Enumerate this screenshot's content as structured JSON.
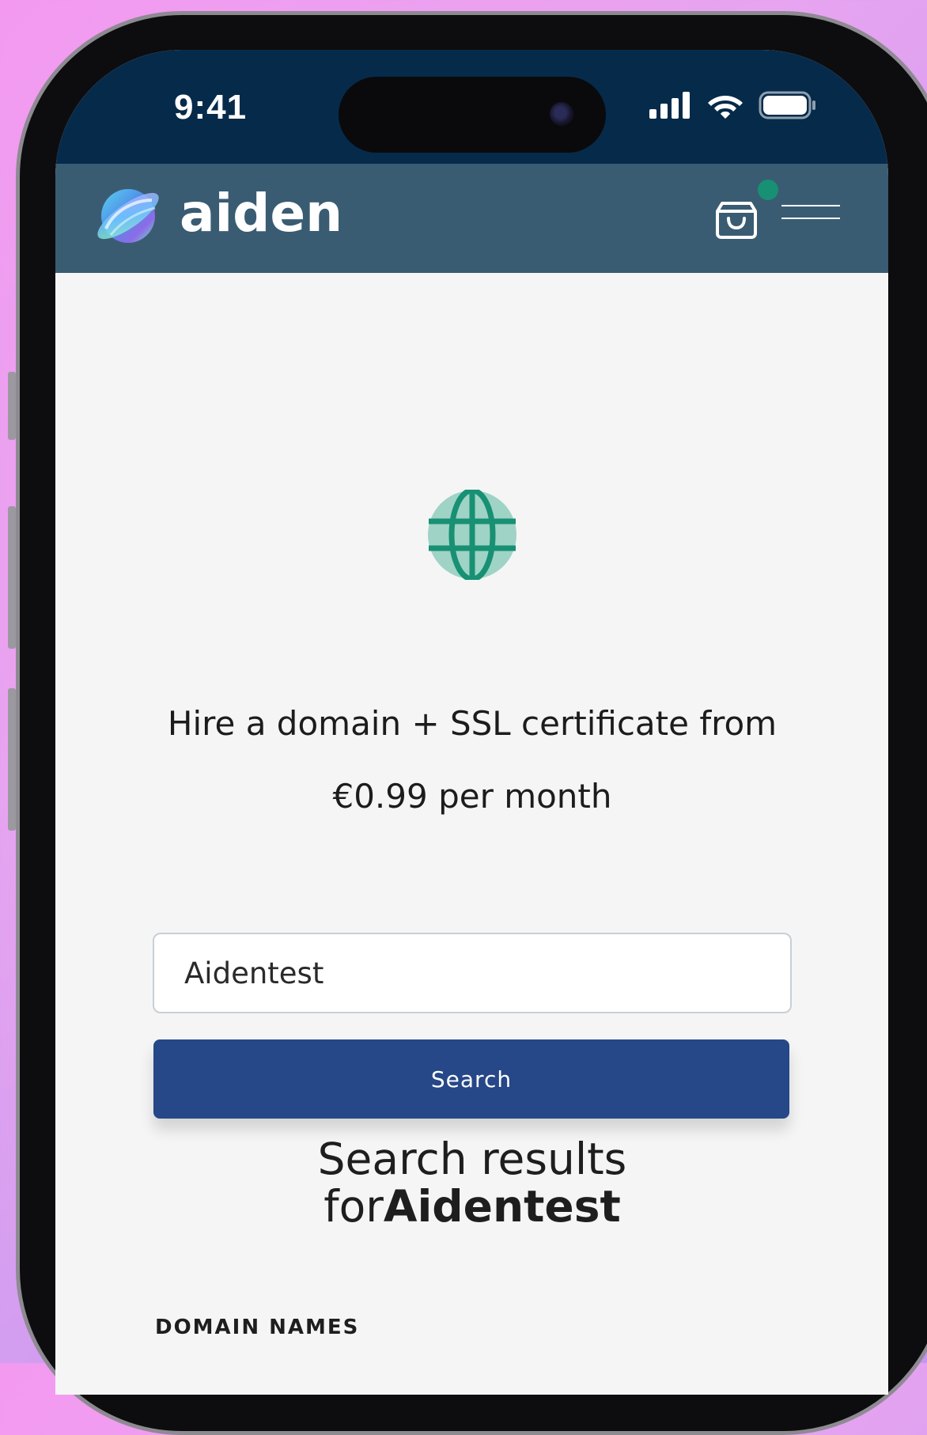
{
  "status_bar": {
    "time": "9:41"
  },
  "navbar": {
    "brand": "aiden",
    "logo_icon": "planet-logo-icon",
    "cart_icon": "shopping-bag-icon",
    "menu_icon": "hamburger-menu-icon"
  },
  "hero": {
    "icon": "globe-icon",
    "headline_line1": "Hire a domain + SSL certificate from",
    "headline_line2": "€0.99 per month"
  },
  "search": {
    "input_value": "Aidentest",
    "button_label": "Search"
  },
  "results": {
    "title_line1": "Search results",
    "title_prefix": "for",
    "title_query": "Aidentest",
    "section_label": "DOMAIN NAMES"
  },
  "colors": {
    "status_bar_bg": "#062a4a",
    "navbar_bg": "#3a5c72",
    "primary_button": "#264788",
    "accent_green": "#179073",
    "globe_fill": "#9fd3c5"
  }
}
